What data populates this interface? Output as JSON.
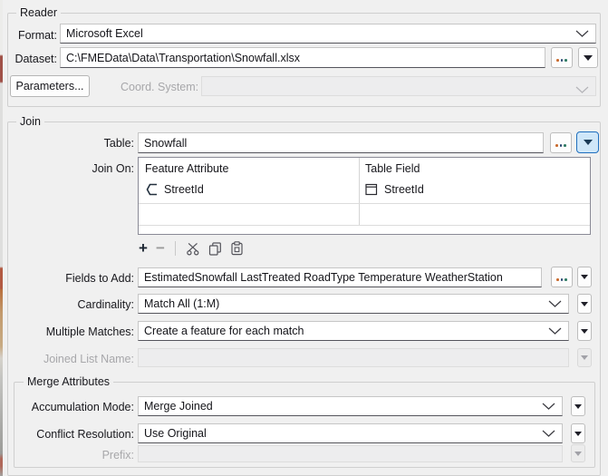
{
  "reader": {
    "title": "Reader",
    "format_label": "Format:",
    "format_value": "Microsoft Excel",
    "dataset_label": "Dataset:",
    "dataset_value": "C:\\FMEData\\Data\\Transportation\\Snowfall.xlsx",
    "parameters_button": "Parameters...",
    "coord_system_label": "Coord. System:",
    "coord_system_value": ""
  },
  "join": {
    "title": "Join",
    "table_label": "Table:",
    "table_value": "Snowfall",
    "join_on_label": "Join On:",
    "join_on_table": {
      "columns": [
        "Feature Attribute",
        "Table Field"
      ],
      "rows": [
        {
          "feature_attribute": "StreetId",
          "table_field": "StreetId"
        }
      ]
    },
    "toolbar": {
      "add": "+",
      "remove": "−"
    },
    "fields_to_add_label": "Fields to Add:",
    "fields_to_add_value": "EstimatedSnowfall LastTreated RoadType Temperature WeatherStation",
    "cardinality_label": "Cardinality:",
    "cardinality_value": "Match All (1:M)",
    "multiple_matches_label": "Multiple Matches:",
    "multiple_matches_value": "Create a feature for each match",
    "joined_list_name_label": "Joined List Name:",
    "joined_list_name_value": ""
  },
  "merge_attributes": {
    "title": "Merge Attributes",
    "accumulation_mode_label": "Accumulation Mode:",
    "accumulation_mode_value": "Merge Joined",
    "conflict_resolution_label": "Conflict Resolution:",
    "conflict_resolution_value": "Use Original",
    "prefix_label": "Prefix:",
    "prefix_value": ""
  },
  "colors": {
    "highlight_button_bg": "#cfe7f9",
    "highlight_button_border": "#1f6fbe",
    "panel_bg": "#f0f0f0",
    "field_bg": "#ffffff",
    "disabled_field_bg": "#ededee"
  }
}
